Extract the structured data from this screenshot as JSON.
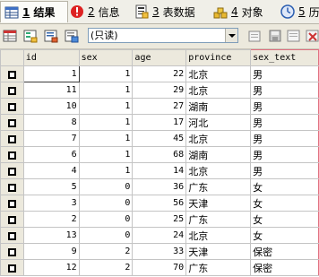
{
  "tabs": [
    {
      "num": "1",
      "label": "结果",
      "icon": "grid-icon",
      "active": true
    },
    {
      "num": "2",
      "label": "信息",
      "icon": "info-icon",
      "active": false
    },
    {
      "num": "3",
      "label": "表数据",
      "icon": "table-icon",
      "active": false
    },
    {
      "num": "4",
      "label": "对象",
      "icon": "objects-icon",
      "active": false
    },
    {
      "num": "5",
      "label": "历",
      "icon": "history-icon",
      "active": false
    }
  ],
  "toolbar": {
    "mode_value": "(只读)"
  },
  "grid": {
    "columns": [
      "id",
      "sex",
      "age",
      "province",
      "sex_text"
    ],
    "rows": [
      [
        "1",
        "1",
        "22",
        "北京",
        "男"
      ],
      [
        "11",
        "1",
        "29",
        "北京",
        "男"
      ],
      [
        "10",
        "1",
        "27",
        "湖南",
        "男"
      ],
      [
        "8",
        "1",
        "17",
        "河北",
        "男"
      ],
      [
        "7",
        "1",
        "45",
        "北京",
        "男"
      ],
      [
        "6",
        "1",
        "68",
        "湖南",
        "男"
      ],
      [
        "4",
        "1",
        "14",
        "北京",
        "男"
      ],
      [
        "5",
        "0",
        "36",
        "广东",
        "女"
      ],
      [
        "3",
        "0",
        "56",
        "天津",
        "女"
      ],
      [
        "2",
        "0",
        "25",
        "广东",
        "女"
      ],
      [
        "13",
        "0",
        "24",
        "北京",
        "女"
      ],
      [
        "9",
        "2",
        "33",
        "天津",
        "保密"
      ],
      [
        "12",
        "2",
        "70",
        "广东",
        "保密"
      ]
    ]
  },
  "colors": {
    "accent_red": "#cc2222",
    "chrome": "#ece9dd",
    "highlight_border": "#e07080"
  }
}
